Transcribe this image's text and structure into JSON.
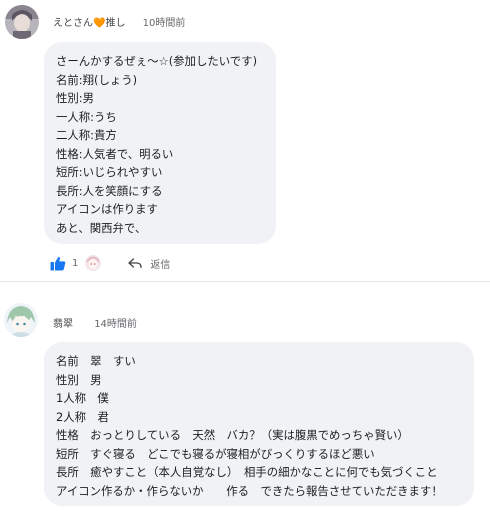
{
  "comments": [
    {
      "author": "えとさん🧡推し",
      "time": "10時間前",
      "lines": [
        "さーんかするぜぇ～☆(参加したいです)",
        "名前:翔(しょう)",
        "性別:男",
        "一人称:うち",
        "二人称:貴方",
        "性格:人気者で、明るい",
        "短所:いじられやすい",
        "長所:人を笑顔にする",
        "アイコンは作ります",
        "あと、関西弁で、"
      ],
      "like_count": "1",
      "reply_label": "返信"
    },
    {
      "author": "翡翠",
      "time": "14時間前",
      "lines": [
        "名前　翠　すい",
        "性別　男",
        "1人称　僕",
        "2人称　君",
        "性格　おっとりしている　天然　バカ？（実は腹黒でめっちゃ賢い）",
        "短所　すぐ寝る　どこでも寝るが寝相がびっくりするほど悪い",
        "長所　癒やすこと（本人自覚なし）　相手の細かなことに何でも気づくこと",
        "アイコン作るか・作らないか　　作る　できたら報告させていただきます！"
      ]
    }
  ],
  "colors": {
    "bubble": "#f0f2f5",
    "like_blue": "#1877f2",
    "meta_gray": "#65676b"
  }
}
